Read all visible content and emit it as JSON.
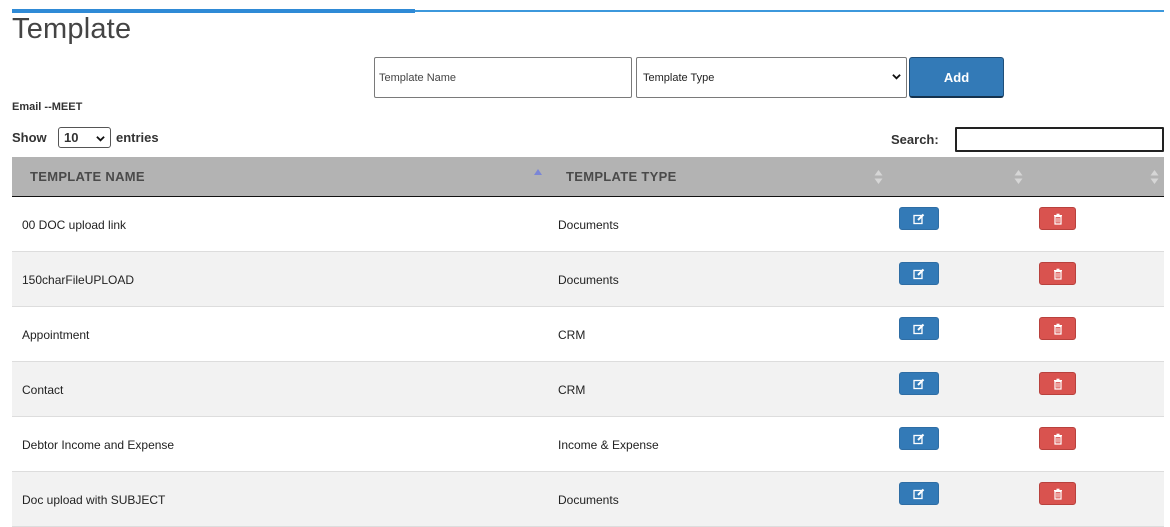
{
  "page": {
    "title": "Template",
    "subtitle": "Email --MEET"
  },
  "form": {
    "name_placeholder": "Template Name",
    "type_selected": "Template Type",
    "add_label": "Add"
  },
  "table_controls": {
    "show_label": "Show",
    "length_value": "10",
    "entries_label": "entries",
    "search_label": "Search:"
  },
  "columns": {
    "name": "TEMPLATE NAME",
    "type": "TEMPLATE TYPE"
  },
  "rows": [
    {
      "name": "00 DOC upload link",
      "type": "Documents"
    },
    {
      "name": "150charFileUPLOAD",
      "type": "Documents"
    },
    {
      "name": "Appointment",
      "type": "CRM"
    },
    {
      "name": "Contact",
      "type": "CRM"
    },
    {
      "name": "Debtor Income and Expense",
      "type": "Income & Expense"
    },
    {
      "name": "Doc upload with SUBJECT",
      "type": "Documents"
    }
  ],
  "icons": {
    "edit": "edit-icon",
    "delete": "trash-icon",
    "sort": "sort-icon",
    "dropdown": "chevron-down-icon"
  },
  "colors": {
    "accent": "#337ab7",
    "danger": "#d9534f",
    "header_bg": "#b3b3b3",
    "top_rule": "#2f8ad6"
  }
}
